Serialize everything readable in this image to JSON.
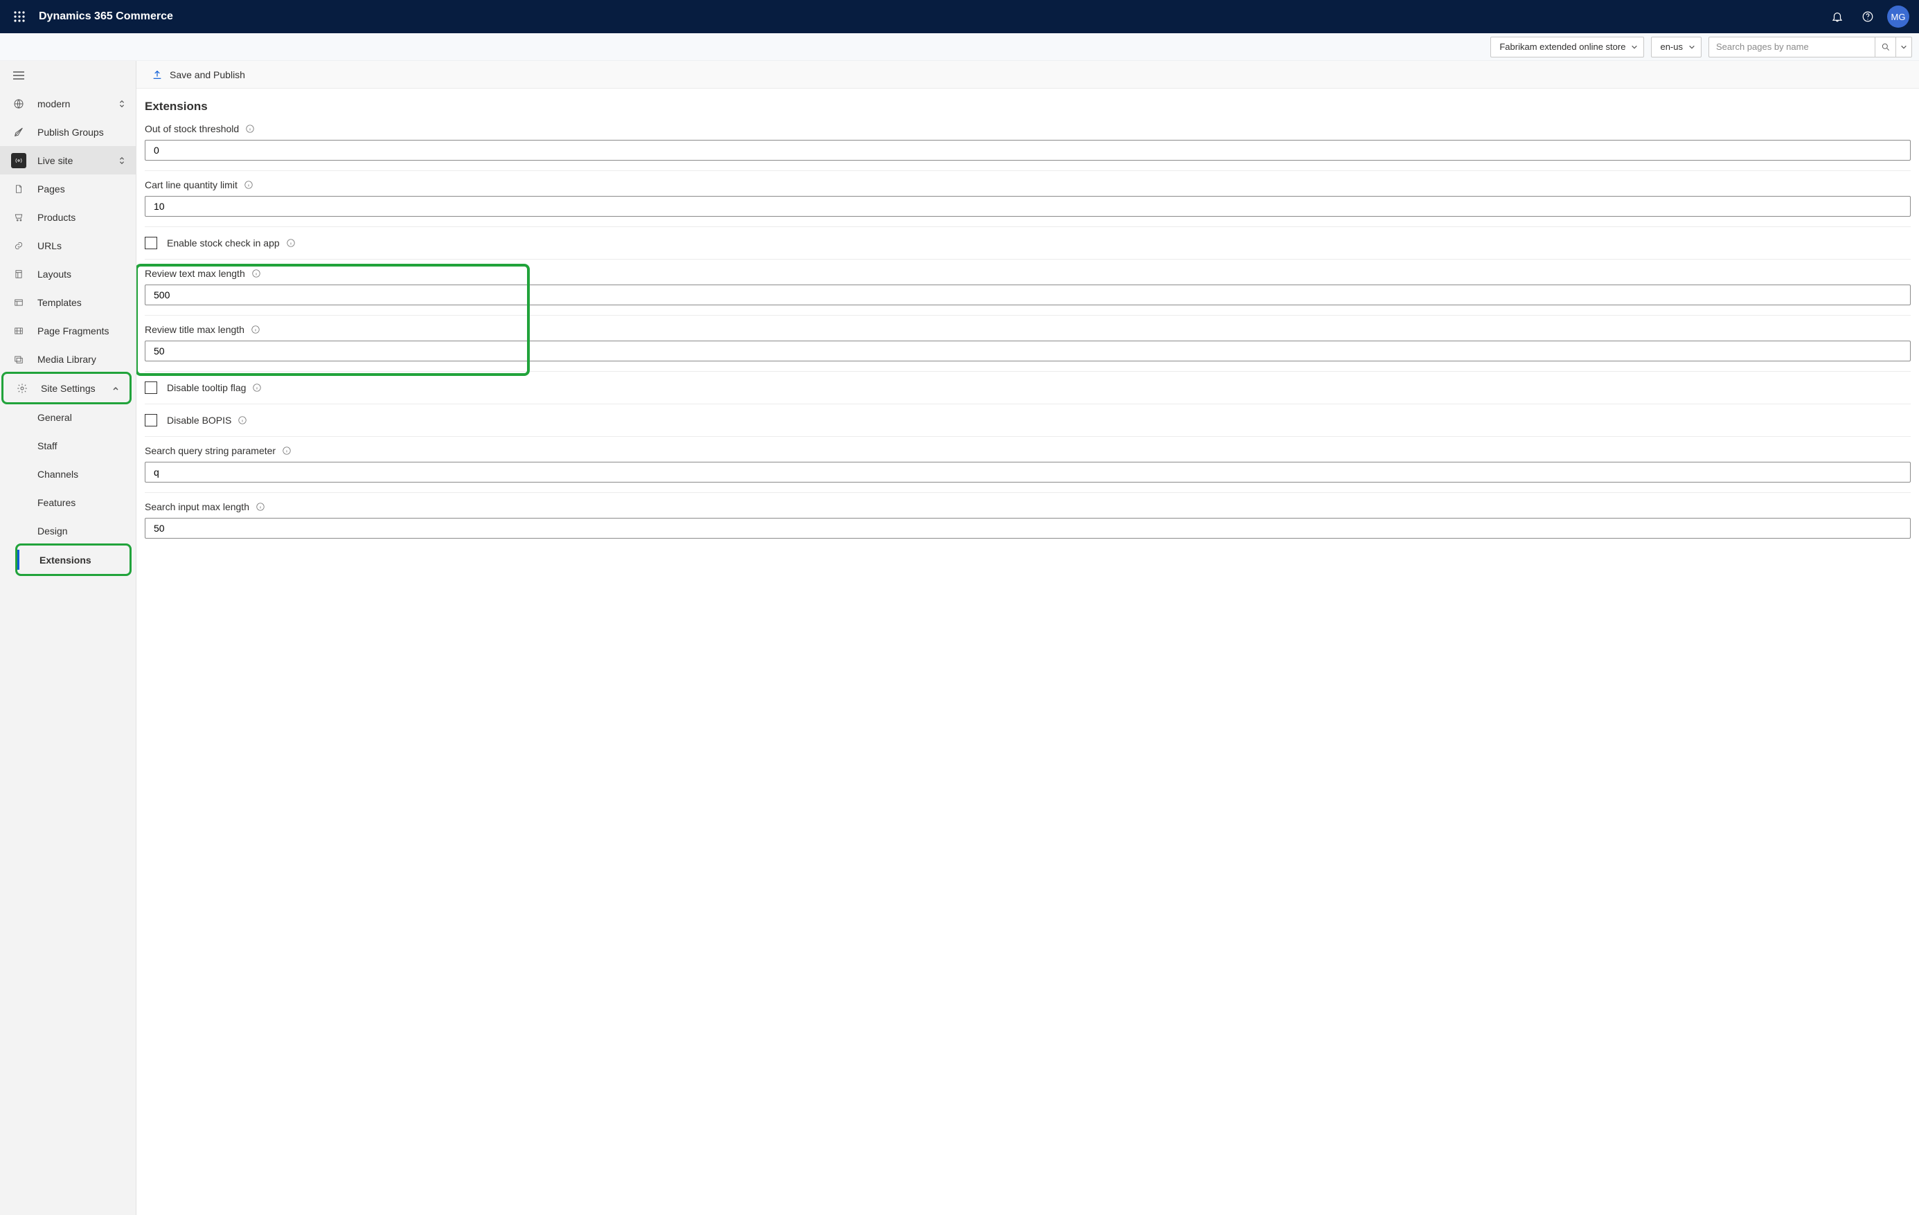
{
  "header": {
    "app_title": "Dynamics 365 Commerce",
    "avatar_initials": "MG"
  },
  "subbar": {
    "store_label": "Fabrikam extended online store",
    "locale_label": "en-us",
    "search_placeholder": "Search pages by name"
  },
  "sidebar": {
    "modern_label": "modern",
    "publish_groups_label": "Publish Groups",
    "live_site_label": "Live site",
    "pages_label": "Pages",
    "products_label": "Products",
    "urls_label": "URLs",
    "layouts_label": "Layouts",
    "templates_label": "Templates",
    "fragments_label": "Page Fragments",
    "media_label": "Media Library",
    "site_settings_label": "Site Settings",
    "sub": {
      "general_label": "General",
      "staff_label": "Staff",
      "channels_label": "Channels",
      "features_label": "Features",
      "design_label": "Design",
      "extensions_label": "Extensions"
    }
  },
  "toolbar": {
    "save_publish_label": "Save and Publish"
  },
  "page": {
    "title": "Extensions",
    "out_of_stock_label": "Out of stock threshold",
    "out_of_stock_value": "0",
    "cart_limit_label": "Cart line quantity limit",
    "cart_limit_value": "10",
    "enable_stock_check_label": "Enable stock check in app",
    "review_text_max_label": "Review text max length",
    "review_text_max_value": "500",
    "review_title_max_label": "Review title max length",
    "review_title_max_value": "50",
    "disable_tooltip_label": "Disable tooltip flag",
    "disable_bopis_label": "Disable BOPIS",
    "search_query_param_label": "Search query string parameter",
    "search_query_param_value": "q",
    "search_input_max_label": "Search input max length",
    "search_input_max_value": "50"
  }
}
